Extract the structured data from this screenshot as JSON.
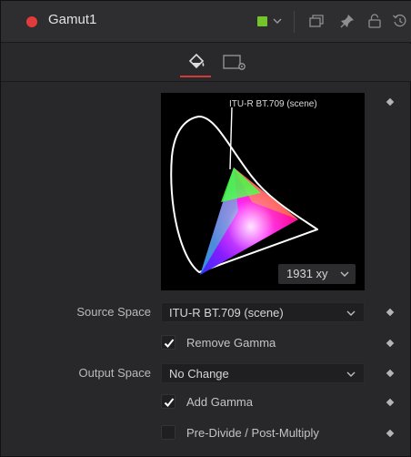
{
  "header": {
    "title": "Gamut1",
    "node_color": "#74c52a",
    "icons": [
      "close-dot",
      "color-swatch",
      "chevron-down-icon",
      "versions-icon",
      "pin-icon",
      "lock-icon",
      "reset-icon"
    ]
  },
  "tabs": [
    {
      "name": "controls-tab",
      "icon": "paint-bucket-icon",
      "active": true
    },
    {
      "name": "settings-tab",
      "icon": "settings-tab-icon",
      "active": false
    }
  ],
  "gamut_view": {
    "label": "ITU-R BT.709 (scene)",
    "plot_mode": "1931 xy"
  },
  "controls": {
    "source_space_label": "Source Space",
    "source_space_value": "ITU-R BT.709 (scene)",
    "remove_gamma_label": "Remove Gamma",
    "remove_gamma_checked": true,
    "output_space_label": "Output Space",
    "output_space_value": "No Change",
    "add_gamma_label": "Add Gamma",
    "add_gamma_checked": true,
    "predivide_label": "Pre-Divide / Post-Multiply",
    "predivide_checked": false
  },
  "accent_color": "#d23a3a"
}
